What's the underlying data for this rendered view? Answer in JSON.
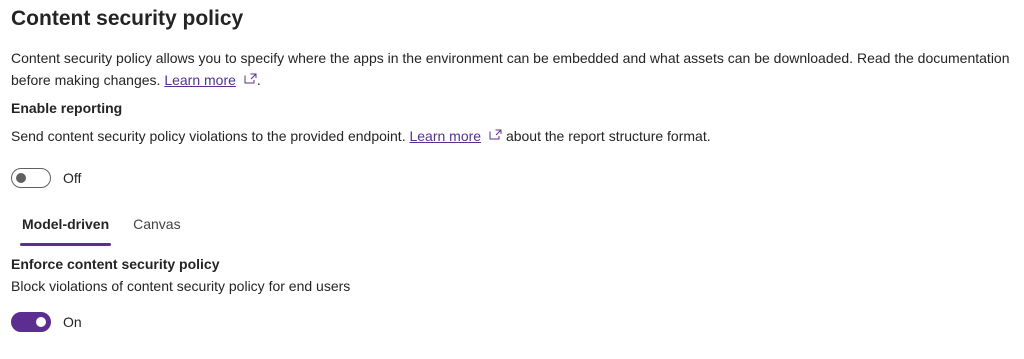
{
  "page": {
    "title": "Content security policy",
    "description": "Content security policy allows you to specify where the apps in the environment can be embedded and what assets can be downloaded. Read the documentation before making changes.",
    "description_prefix": "Content security policy allows you to specify where the apps in the environment can be embedded and what assets can be downloaded. Read the documentation before making changes. ",
    "learn_more": "Learn more",
    "description_suffix": "."
  },
  "reporting": {
    "heading": "Enable reporting",
    "text_prefix": "Send content security policy violations to the provided endpoint. ",
    "learn_more": "Learn more",
    "text_suffix": " about the report structure format.",
    "toggle_state": "Off"
  },
  "tabs": {
    "model_driven": "Model-driven",
    "canvas": "Canvas",
    "selected": "Model-driven"
  },
  "enforce": {
    "heading": "Enforce content security policy",
    "text": "Block violations of content security policy for end users",
    "toggle_state": "On"
  },
  "icons": {
    "external_link": "external-link-icon"
  },
  "colors": {
    "accent": "#5c2e91",
    "text": "#242424",
    "toggle_off_border": "#616161"
  }
}
